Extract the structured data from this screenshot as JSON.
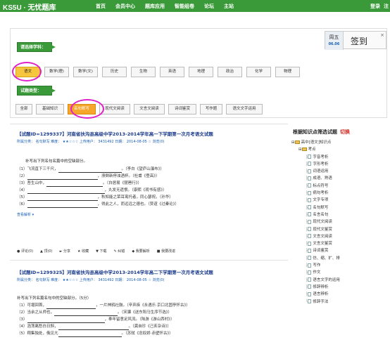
{
  "topbar": {
    "brand": "KS5U · 无忧题库",
    "nav": [
      "首页",
      "会员中心",
      "题库应用",
      "智能组卷",
      "论坛",
      "主站"
    ],
    "login": "登录",
    "register": "注"
  },
  "signin": {
    "weekday": "周五",
    "date": "06.06",
    "label": "签到",
    "close": "×"
  },
  "filters": {
    "subject_label": "请选择学科：",
    "subjects": [
      "语文",
      "数学(理)",
      "数学(文)",
      "历史",
      "生物",
      "英语",
      "地理",
      "政治",
      "化学",
      "物理"
    ],
    "type_label": "试题类型：",
    "types": [
      "全部",
      "基础知识",
      "名句默写",
      "现代文阅读",
      "文言文阅读",
      "诗词鉴赏",
      "写作题",
      "语文文字运用"
    ]
  },
  "articles": [
    {
      "title": "【试题ID=1299337】河南省扶沟县高级中学2013-2014学年高一下学期第一次月考语文试题",
      "meta": "所属分类： 名句默写   难度： ★★☆☆☆   上传用户： 3431492   日期： 2014-08-05   ☆ 浏览(0)",
      "instr": "补写出下列名句名篇中的空缺部分。",
      "lines": [
        {
          "pre": "（1）飞流直下三千尺，",
          "post": "。（李白《望庐山瀑布》）"
        },
        {
          "pre": "（2）",
          "post": "，潦倒新停浊酒杯。（杜甫《登高》）"
        },
        {
          "pre": "（3）吾生山中，",
          "post": "。（白居易《琵琶行》）"
        },
        {
          "pre": "（4）",
          "post": "，丸发无遗恨。（康熙《观书有感》）"
        },
        {
          "pre": "（5）",
          "post": "，秋知能之荣耳鸾托者，同心瑟祝。（孙华）"
        },
        {
          "pre": "（6）",
          "post": "，得此之人，而远远之德也。（贾谊《过秦论》）"
        }
      ],
      "more": "查看解析 ▾",
      "actions": [
        "● 评论(0)",
        "▲ 顶(0)",
        "► 分享",
        "★ 收藏",
        "▼ 下载",
        "✎ 纠错",
        "◆ 我要解析",
        "■ 我要改进"
      ]
    },
    {
      "title": "【试题ID=1299325】河南省扶沟县高级中学2013-2014学年高二下学期第一次月考语文试题",
      "meta": "所属分类： 名句默写   难度： ★★☆☆☆   上传用户： 3431492   日期： 2014-08-05   ☆ 浏览(0)",
      "instr": "补写出下列名篇名句中的空缺部分。（5分）",
      "lines": [
        {
          "pre": "（1）可堪回首，",
          "post": "，一片神鸦社鼓。（辛弃疾《永遇乐·京口北固亭怀古》）"
        },
        {
          "pre": "（2）当余之从师也，",
          "post": "。（宋濂《送东阳马生序节选》）"
        },
        {
          "pre": "（3）",
          "post": "，奉年留意足风流。（陆游《游山西村》）"
        },
        {
          "pre": "（4）浩荡离愁白日斜，",
          "post": "。（龚自珍《己亥杂诗》）"
        },
        {
          "pre": "（5）翔集独处，俄见亢",
          "post": "。（苏轼《念奴娇·赤壁怀古》）"
        }
      ]
    }
  ],
  "sidebar": {
    "title": "根据知识点筛选试题",
    "switch": "切换",
    "tree": {
      "root": "高中[语文]知识点",
      "group": "考点",
      "items": [
        "字音考析",
        "字形考析",
        "词语运用",
        "成语、熟语",
        "标点符号",
        "病句考析",
        "文字专项",
        "名句默写",
        "名言名句",
        "现代文阅读",
        "现代文鉴赏",
        "文言文阅读",
        "文言文鉴赏",
        "诗词鉴赏",
        "仿、缩、扩、排",
        "写作",
        "作文",
        "语言文字的运用",
        "修辞辨析",
        "语言辨析",
        "修辞手法"
      ]
    }
  }
}
